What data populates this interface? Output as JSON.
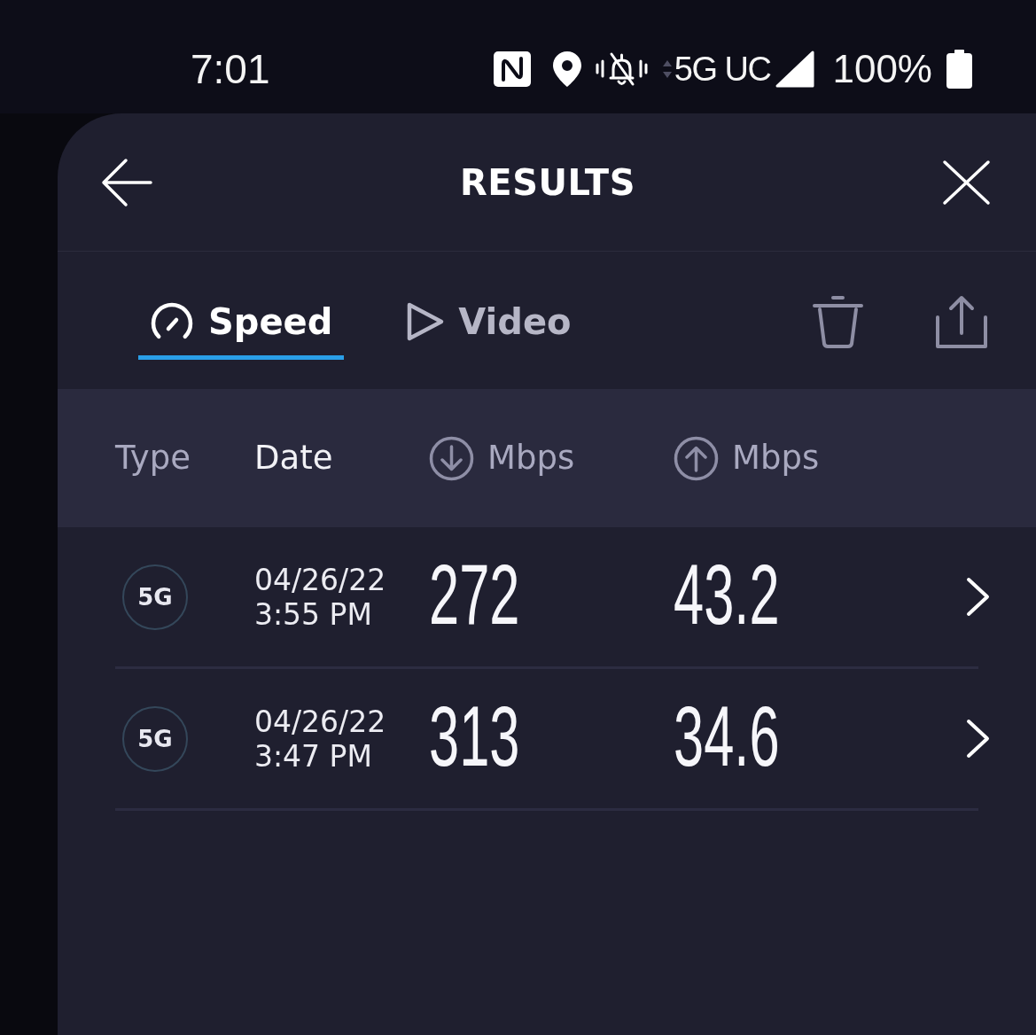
{
  "status_bar": {
    "time": "7:01",
    "network": "5G UC",
    "battery": "100%"
  },
  "header": {
    "title": "RESULTS"
  },
  "tabs": [
    {
      "label": "Speed",
      "kind": "speed",
      "selected": true
    },
    {
      "label": "Video",
      "kind": "video",
      "selected": false
    }
  ],
  "table": {
    "columns": [
      {
        "label": "Type",
        "kind": "text",
        "selected": false
      },
      {
        "label": "Date",
        "kind": "text",
        "selected": true
      },
      {
        "label": "Mbps",
        "kind": "download",
        "selected": false
      },
      {
        "label": "Mbps",
        "kind": "upload",
        "selected": false
      }
    ],
    "rows": [
      {
        "type": "5G",
        "date": "04/26/22",
        "time": "3:55 PM",
        "download": "272",
        "upload": "43.2"
      },
      {
        "type": "5G",
        "date": "04/26/22",
        "time": "3:47 PM",
        "download": "313",
        "upload": "34.6"
      }
    ]
  }
}
